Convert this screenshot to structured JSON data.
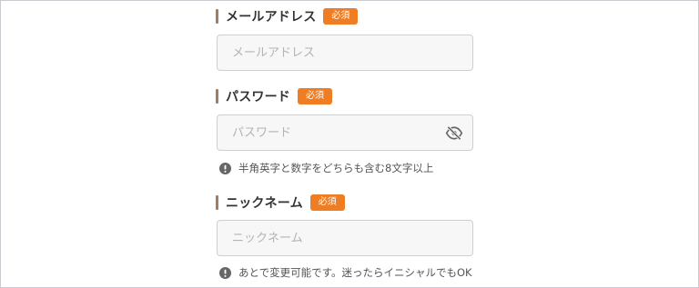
{
  "form": {
    "email": {
      "label": "メールアドレス",
      "badge": "必須",
      "placeholder": "メールアドレス"
    },
    "password": {
      "label": "パスワード",
      "badge": "必須",
      "placeholder": "パスワード",
      "toggle_icon": "eye-slash-icon",
      "hint": "半角英字と数字をどちらも含む8文字以上"
    },
    "nickname": {
      "label": "ニックネーム",
      "badge": "必須",
      "placeholder": "ニックネーム",
      "hint": "あとで変更可能です。迷ったらイニシャルでもOK"
    }
  },
  "colors": {
    "accent": "#ee7d23",
    "label_bar": "#a07e64",
    "field_bg": "#f7f7f7",
    "field_border": "#cfcfcf",
    "hint_icon": "#666666"
  }
}
